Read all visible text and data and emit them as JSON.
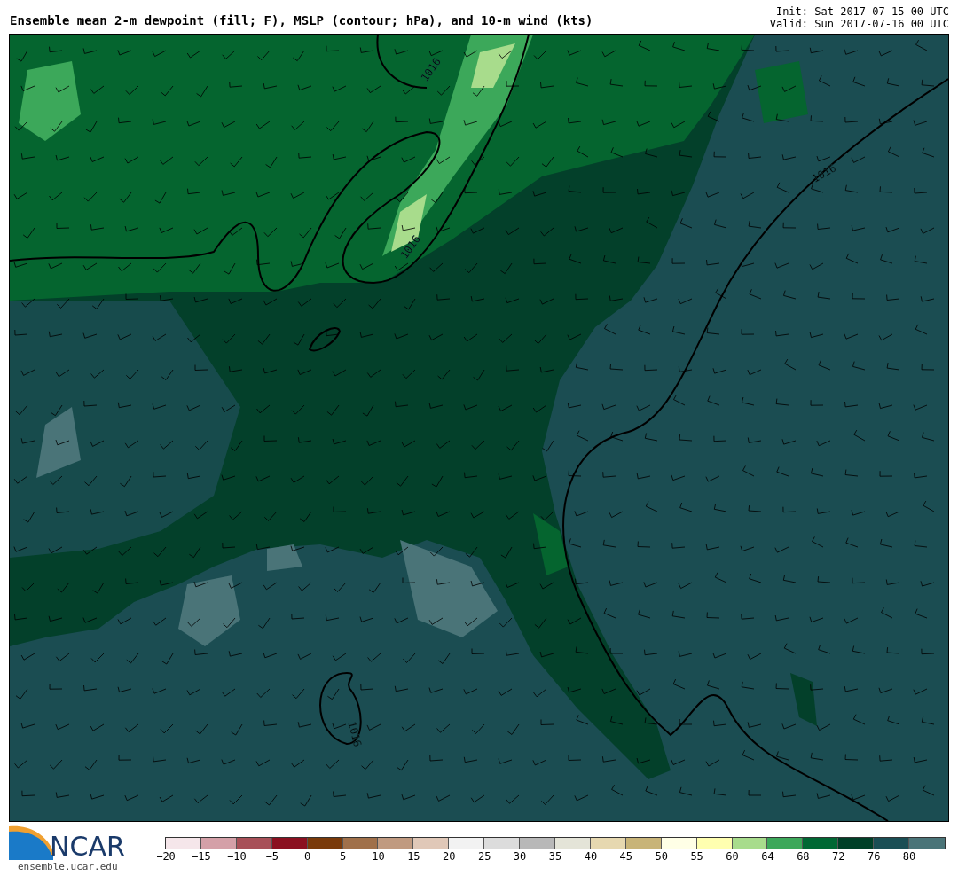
{
  "title": "Ensemble mean 2-m dewpoint (fill; F), MSLP (contour; hPa), and 10-m wind (kts)",
  "init": "Init: Sat 2017-07-15 00 UTC",
  "valid": "Valid: Sun 2017-07-16 00 UTC",
  "map": {
    "contour_labels": [
      "1016",
      "1016",
      "1016",
      "1016"
    ]
  },
  "logo": {
    "text": "NCAR",
    "url": "ensemble.ucar.edu"
  },
  "colorbar": {
    "segments": [
      {
        "color": "#f5e6ea"
      },
      {
        "color": "#d4a0a8"
      },
      {
        "color": "#a85058"
      },
      {
        "color": "#8b1020"
      },
      {
        "color": "#7a3a0a"
      },
      {
        "color": "#a0704a"
      },
      {
        "color": "#c09a80"
      },
      {
        "color": "#e0c8b8"
      },
      {
        "color": "#f2f2f2"
      },
      {
        "color": "#dcdcdc"
      },
      {
        "color": "#b8b8b8"
      },
      {
        "color": "#e4e4d8"
      },
      {
        "color": "#e6d8b0"
      },
      {
        "color": "#c8b478"
      },
      {
        "color": "#ffffe6"
      },
      {
        "color": "#ffffb0"
      },
      {
        "color": "#a8dc8c"
      },
      {
        "color": "#3ca85a"
      },
      {
        "color": "#006834"
      },
      {
        "color": "#004028"
      },
      {
        "color": "#1a4e54"
      },
      {
        "color": "#4a7478"
      }
    ],
    "ticks": [
      "−20",
      "−15",
      "−10",
      "−5",
      "0",
      "5",
      "10",
      "15",
      "20",
      "25",
      "30",
      "35",
      "40",
      "45",
      "50",
      "55",
      "60",
      "64",
      "68",
      "72",
      "76",
      "80"
    ]
  }
}
